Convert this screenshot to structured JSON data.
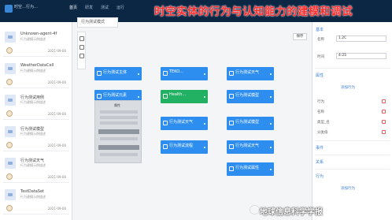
{
  "app": {
    "title": "时空…行为…",
    "nav": [
      "首页",
      "研发",
      "测试",
      "运行"
    ],
    "active_nav": 0
  },
  "banner": "时空实体的行为与认知能力的建模和调试",
  "left_panel": {
    "add_button": "+ 新建",
    "items": [
      {
        "name": "Unknown-agent-4f",
        "sub": "行为建模示例描述",
        "date": "2021-09-06"
      },
      {
        "name": "WeatherDataCell",
        "sub": "行为建模示例描述",
        "date": "2021-09-06"
      },
      {
        "name": "行为测试用例",
        "sub": "行为建模示例描述",
        "date": "2021-09-06"
      },
      {
        "name": "行为测试模型",
        "sub": "行为建模示例描述",
        "date": "2021-09-06"
      },
      {
        "name": "行为测试天气",
        "sub": "行为建模示例描述",
        "date": "2021-09-06"
      },
      {
        "name": "TestDataSet",
        "sub": "行为建模示例描述",
        "date": "2021-09-06"
      }
    ]
  },
  "canvas": {
    "tab": "行为测试模式",
    "save_label": "保存",
    "nodes": [
      {
        "label": "行为测试主体",
        "color": "blue"
      },
      {
        "label": "TEKO...",
        "color": "blue"
      },
      {
        "label": "行为测试天气",
        "color": "blue"
      },
      {
        "label": "行为测试元素",
        "color": "blue"
      },
      {
        "label": "Health...",
        "color": "green"
      },
      {
        "label": "行为测试模型",
        "color": "blue"
      },
      {
        "label": "行为测试天气",
        "color": "blue"
      },
      {
        "label": "行为测试模型",
        "color": "blue"
      },
      {
        "label": "行为测试流程",
        "color": "blue"
      },
      {
        "label": "行为测试天气",
        "color": "blue"
      },
      {
        "label": "行为测试属性",
        "color": "blue"
      }
    ],
    "panel_title": "属性"
  },
  "right_panel": {
    "section_basic": "基本",
    "field1_label": "名称",
    "field1_value": "1.2C",
    "field2_label": "时间",
    "field2_value": "4:25",
    "section_props": "属性",
    "add_prop": "添加行为",
    "props": [
      "行为",
      "名称",
      "类型_名",
      "分类值"
    ],
    "section_event": "事件",
    "section_relation": "关系",
    "section_behavior": "行为",
    "add_behavior": "添加行为"
  },
  "watermark": "地球信息科学学报",
  "colors": {
    "topbar": "#0b2744",
    "node_blue": "#2d8ef0",
    "node_green": "#22b062",
    "banner": "#ff2b2b"
  }
}
